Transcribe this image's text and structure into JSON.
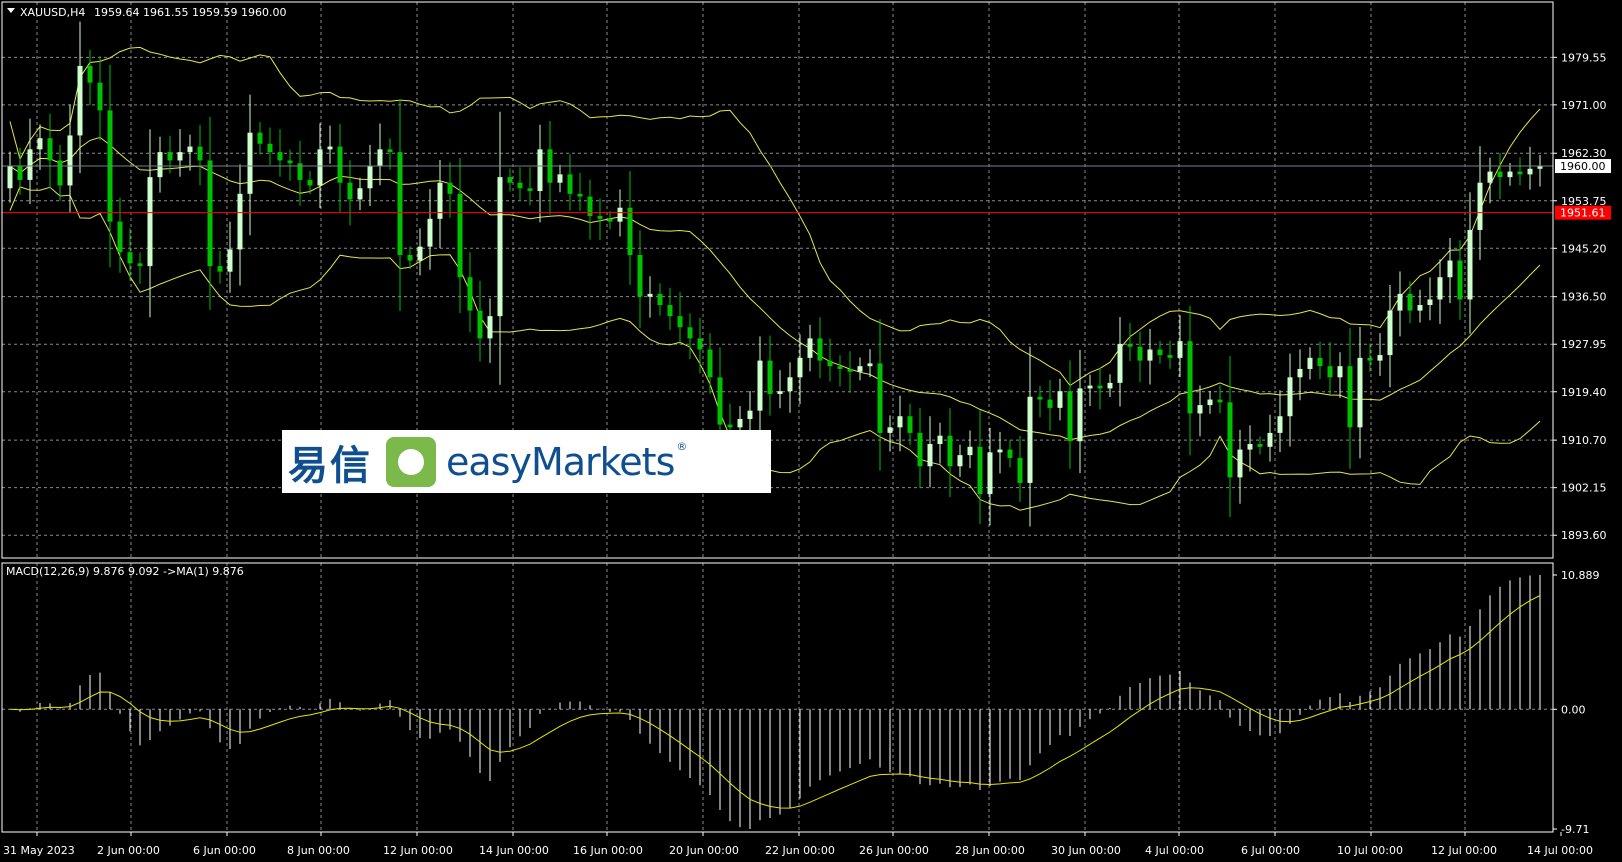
{
  "header": {
    "symbol": "XAUUSD,H4",
    "ohlc": "1959.64 1961.55 1959.59 1960.00"
  },
  "price_axis": {
    "labels": [
      "1979.55",
      "1971.00",
      "1962.30",
      "1953.75",
      "1945.20",
      "1936.50",
      "1927.95",
      "1919.40",
      "1910.70",
      "1902.15",
      "1893.60"
    ],
    "current_price": "1960.00",
    "line_price": "1951.61"
  },
  "macd": {
    "label": "MACD(12,26,9) 9.876 9.092  ->MA(1) 9.876",
    "axis_labels": [
      "10.889",
      "0.00",
      "-9.71"
    ]
  },
  "time_axis": {
    "labels": [
      "31 May 2023",
      "2 Jun 00:00",
      "6 Jun 00:00",
      "8 Jun 00:00",
      "12 Jun 00:00",
      "14 Jun 00:00",
      "16 Jun 00:00",
      "20 Jun 00:00",
      "22 Jun 00:00",
      "26 Jun 00:00",
      "28 Jun 00:00",
      "30 Jun 00:00",
      "4 Jul 00:00",
      "6 Jul 00:00",
      "10 Jul 00:00",
      "12 Jul 00:00",
      "14 Jul 00:00"
    ]
  },
  "logo": {
    "chinese": "易信",
    "brand_left": "easy",
    "brand_right": "Markets",
    "reg_mark": "®"
  },
  "colors": {
    "background": "#000000",
    "grid": "#8a8a8a",
    "bull": "#ccffcc",
    "bear": "#00c000",
    "bands": "#e6e64d",
    "price_line": "#ff0000",
    "macd_hist": "#ffffff",
    "signal": "#e6e600"
  },
  "chart_data": {
    "type": "candlestick",
    "symbol": "XAUUSD",
    "timeframe": "H4",
    "y_range": [
      1889.5,
      1989.5
    ],
    "x_labels": [
      "31 May 2023",
      "2 Jun 00:00",
      "6 Jun 00:00",
      "8 Jun 00:00",
      "12 Jun 00:00",
      "14 Jun 00:00",
      "16 Jun 00:00",
      "20 Jun 00:00",
      "22 Jun 00:00",
      "26 Jun 00:00",
      "28 Jun 00:00",
      "30 Jun 00:00",
      "4 Jul 00:00",
      "6 Jul 00:00",
      "10 Jul 00:00",
      "12 Jul 00:00",
      "14 Jul 00:00"
    ],
    "close": [
      1960.0,
      1957.5,
      1963.0,
      1965.0,
      1961.0,
      1956.5,
      1965.5,
      1978.0,
      1975.0,
      1970.0,
      1950.0,
      1944.5,
      1942.5,
      1942.0,
      1958.0,
      1962.5,
      1961.0,
      1962.5,
      1963.5,
      1961.0,
      1942.0,
      1941.0,
      1945.0,
      1955.0,
      1966.0,
      1964.0,
      1962.5,
      1961.0,
      1960.5,
      1957.5,
      1956.5,
      1963.0,
      1963.5,
      1957.0,
      1954.0,
      1956.0,
      1960.0,
      1963.0,
      1962.5,
      1944.0,
      1943.0,
      1945.5,
      1950.5,
      1957.0,
      1955.0,
      1940.0,
      1934.0,
      1929.0,
      1933.0,
      1958.0,
      1957.0,
      1956.0,
      1955.5,
      1963.0,
      1957.0,
      1958.5,
      1955.0,
      1954.5,
      1951.0,
      1950.5,
      1950.0,
      1952.5,
      1944.0,
      1936.5,
      1937.0,
      1935.0,
      1933.0,
      1931.0,
      1929.0,
      1927.0,
      1922.0,
      1913.5,
      1913.0,
      1914.5,
      1916.0,
      1925.0,
      1919.0,
      1919.5,
      1922.0,
      1925.5,
      1929.0,
      1925.0,
      1924.0,
      1923.5,
      1923.0,
      1924.0,
      1924.5,
      1912.0,
      1913.0,
      1915.0,
      1912.0,
      1906.0,
      1910.0,
      1911.5,
      1906.0,
      1908.0,
      1909.5,
      1901.0,
      1908.5,
      1909.0,
      1907.5,
      1903.0,
      1918.5,
      1918.0,
      1916.5,
      1919.5,
      1910.5,
      1920.0,
      1920.5,
      1920.0,
      1921.0,
      1928.0,
      1927.5,
      1925.0,
      1927.0,
      1926.0,
      1925.5,
      1928.5,
      1915.5,
      1917.0,
      1918.0,
      1917.5,
      1904.0,
      1909.0,
      1910.0,
      1909.5,
      1912.0,
      1915.0,
      1922.0,
      1923.5,
      1925.5,
      1924.0,
      1922.0,
      1924.0,
      1913.0,
      1925.5,
      1925.0,
      1926.0,
      1934.0,
      1937.0,
      1934.0,
      1935.0,
      1936.0,
      1940.0,
      1943.0,
      1936.0,
      1948.5,
      1957.0,
      1959.0,
      1958.0,
      1959.0,
      1958.5,
      1959.5,
      1960.0
    ],
    "current_price": 1960.0,
    "horizontal_line": 1951.61,
    "macd_range": [
      -9.71,
      10.889
    ],
    "macd_params": "MACD(12,26,9)",
    "macd_value": 9.876,
    "macd_signal": 9.092
  }
}
